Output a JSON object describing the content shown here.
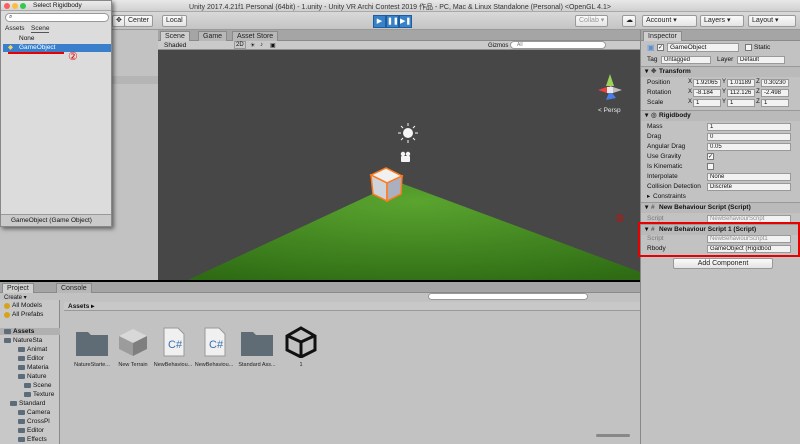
{
  "window": {
    "title": "Unity 2017.4.21f1 Personal (64bit) - 1.unity - Unity VR Archi Contest 2019 作品 - PC, Mac & Linux Standalone (Personal) <OpenGL 4.1>"
  },
  "toolbar": {
    "center": "Center",
    "local": "Local",
    "collab": "Collab ▾",
    "account": "Account",
    "layers": "Layers",
    "layout": "Layout"
  },
  "picker": {
    "title": "Select Rigidbody",
    "tabs": [
      "Assets",
      "Scene"
    ],
    "items": [
      "None",
      "GameObject"
    ],
    "footer": "GameObject (Game Object)"
  },
  "scene": {
    "tabs": [
      "Scene",
      "Game",
      "Asset Store"
    ],
    "shading": "Shaded",
    "mode2d": "2D",
    "gizmos": "Gizmos ▾",
    "search_placeholder": "All",
    "persp": "< Persp",
    "colors": {
      "sky": "#474747",
      "grass": "#3f8a1f",
      "cube_outline": "#ff7a1a"
    }
  },
  "inspector": {
    "tab": "Inspector",
    "object_name": "GameObject",
    "static_label": "Static",
    "tag_label": "Tag",
    "tag_value": "Untagged",
    "layer_label": "Layer",
    "layer_value": "Default",
    "transform": {
      "title": "Transform",
      "rows": [
        {
          "label": "Position",
          "x": "1.92065",
          "y": "1.01189",
          "z": "0.30230"
        },
        {
          "label": "Rotation",
          "x": "-8.184",
          "y": "112.126",
          "z": "-2.498"
        },
        {
          "label": "Scale",
          "x": "1",
          "y": "1",
          "z": "1"
        }
      ]
    },
    "rigidbody": {
      "title": "Rigidbody",
      "mass_label": "Mass",
      "mass": "1",
      "drag_label": "Drag",
      "drag": "0",
      "angular_drag_label": "Angular Drag",
      "angular_drag": "0.05",
      "use_gravity_label": "Use Gravity",
      "is_kinematic_label": "Is Kinematic",
      "interpolate_label": "Interpolate",
      "interpolate": "None",
      "collision_label": "Collision Detection",
      "collision": "Discrete",
      "constraints_label": "Constraints"
    },
    "nbs": {
      "title": "New Behaviour Script (Script)",
      "script_label": "Script",
      "script_value": "NewBehaviourScript"
    },
    "nbs1": {
      "title": "New Behaviour Script 1 (Script)",
      "script_label": "Script",
      "script_value": "NewBehaviourScript1",
      "rbody_label": "Rbody",
      "rbody_value": "GameObject (Rigidbod"
    },
    "add_component": "Add Component"
  },
  "project": {
    "tabs": [
      "Project",
      "Console"
    ],
    "create": "Create ▾",
    "favorites": [
      "All Models",
      "All Prefabs"
    ],
    "tree": [
      "Assets",
      "NatureSta",
      "Animat",
      "Editor",
      "Materia",
      "Nature",
      "Scene",
      "Texture",
      "Standard",
      "Camera",
      "CrossPl",
      "Editor",
      "Effects"
    ],
    "breadcrumb": "Assets ▸",
    "assets": [
      "NatureStarte...",
      "New Terrain",
      "NewBehaviou...",
      "NewBehaviou...",
      "Standard Ass...",
      "1"
    ]
  },
  "annotations": {
    "one": "①",
    "two": "②",
    "color": "#e60000"
  }
}
